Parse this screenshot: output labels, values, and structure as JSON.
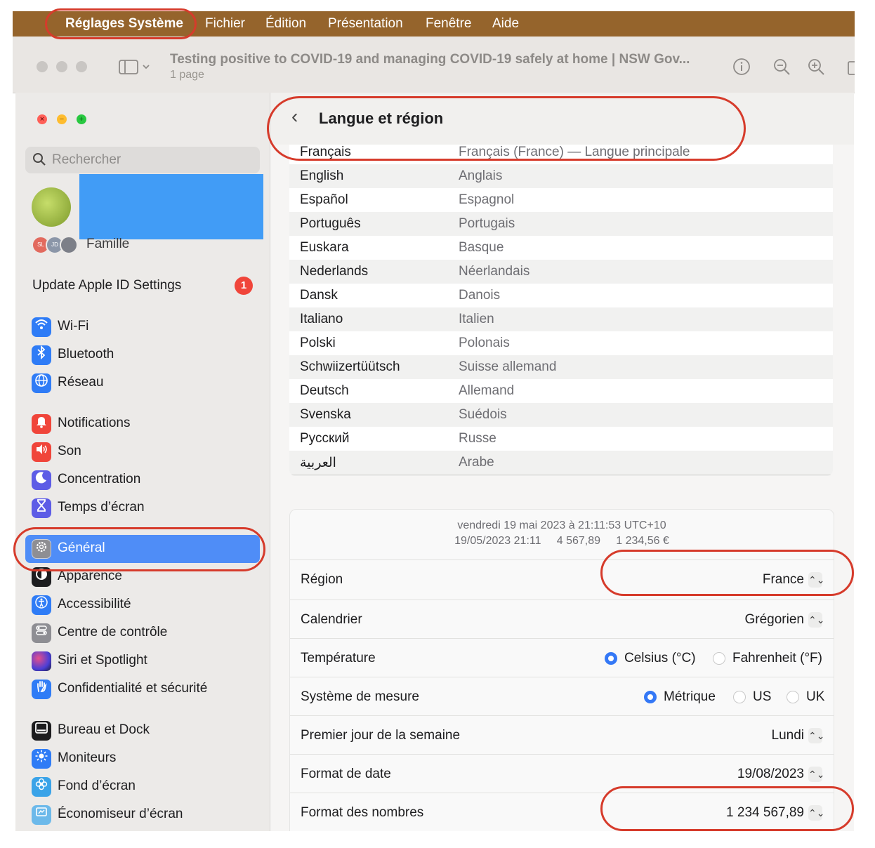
{
  "menubar": {
    "apple_icon": "",
    "app_name": "Réglages Système",
    "items": [
      "Fichier",
      "Édition",
      "Présentation",
      "Fenêtre",
      "Aide"
    ]
  },
  "preview": {
    "title": "Testing positive to COVID-19 and managing COVID-19 safely at home | NSW Gov...",
    "subtitle": "1 page",
    "icons": [
      "sidebar-toggle-icon",
      "info-icon",
      "zoom-out-icon",
      "zoom-in-icon",
      "share-icon"
    ]
  },
  "sidebar": {
    "search_placeholder": "Rechercher",
    "family_label": "Famille",
    "family_avatars": [
      "SL",
      "JD",
      ""
    ],
    "update_label": "Update Apple ID Settings",
    "update_badge": "1",
    "groups": [
      [
        {
          "label": "Wi-Fi",
          "icon": "wifi-icon",
          "color": "#2f7cf6"
        },
        {
          "label": "Bluetooth",
          "icon": "bluetooth-icon",
          "color": "#2f7cf6"
        },
        {
          "label": "Réseau",
          "icon": "globe-icon",
          "color": "#2f7cf6"
        }
      ],
      [
        {
          "label": "Notifications",
          "icon": "bell-icon",
          "color": "#f0453a"
        },
        {
          "label": "Son",
          "icon": "speaker-icon",
          "color": "#f0453a"
        },
        {
          "label": "Concentration",
          "icon": "moon-icon",
          "color": "#5d5ce6"
        },
        {
          "label": "Temps d’écran",
          "icon": "hourglass-icon",
          "color": "#5d5ce6"
        }
      ],
      [
        {
          "label": "Général",
          "icon": "gear-icon",
          "color": "#8e8e93",
          "selected": true
        },
        {
          "label": "Apparence",
          "icon": "appearance-icon",
          "color": "#1d1d1f"
        },
        {
          "label": "Accessibilité",
          "icon": "accessibility-icon",
          "color": "#2f7cf6"
        },
        {
          "label": "Centre de contrôle",
          "icon": "control-center-icon",
          "color": "#8e8e93"
        },
        {
          "label": "Siri et Spotlight",
          "icon": "siri-icon",
          "color": "#6b3fd6"
        },
        {
          "label": "Confidentialité et sécurité",
          "icon": "hand-icon",
          "color": "#2f7cf6"
        }
      ],
      [
        {
          "label": "Bureau et Dock",
          "icon": "dock-icon",
          "color": "#1d1d1f"
        },
        {
          "label": "Moniteurs",
          "icon": "sun-icon",
          "color": "#2f7cf6"
        },
        {
          "label": "Fond d’écran",
          "icon": "flower-icon",
          "color": "#3aa3e8"
        },
        {
          "label": "Économiseur d’écran",
          "icon": "screensaver-icon",
          "color": "#3aa3e8"
        }
      ]
    ]
  },
  "content": {
    "back_icon": "‹",
    "title": "Langue et région",
    "languages": [
      {
        "name": "Français",
        "translation": "Français (France) — Langue principale"
      },
      {
        "name": "English",
        "translation": "Anglais"
      },
      {
        "name": "Español",
        "translation": "Espagnol"
      },
      {
        "name": "Português",
        "translation": "Portugais"
      },
      {
        "name": "Euskara",
        "translation": "Basque"
      },
      {
        "name": "Nederlands",
        "translation": "Néerlandais"
      },
      {
        "name": "Dansk",
        "translation": "Danois"
      },
      {
        "name": "Italiano",
        "translation": "Italien"
      },
      {
        "name": "Polski",
        "translation": "Polonais"
      },
      {
        "name": "Schwiizertüütsch",
        "translation": "Suisse allemand"
      },
      {
        "name": "Deutsch",
        "translation": "Allemand"
      },
      {
        "name": "Svenska",
        "translation": "Suédois"
      },
      {
        "name": "Русский",
        "translation": "Russe"
      },
      {
        "name": "العربية",
        "translation": "Arabe"
      }
    ],
    "toolbar": {
      "add": "+",
      "remove": "−",
      "action": "⊛ ⌄"
    },
    "format_preview": {
      "line1": "vendredi 19 mai 2023 à 21:11:53 UTC+10",
      "line2": "19/05/2023 21:11     4 567,89     1 234,56 €"
    },
    "settings": {
      "region": {
        "label": "Région",
        "value": "France"
      },
      "calendar": {
        "label": "Calendrier",
        "value": "Grégorien"
      },
      "temperature": {
        "label": "Température",
        "options": [
          "Celsius (°C)",
          "Fahrenheit (°F)"
        ],
        "selected": "Celsius (°C)"
      },
      "measurement": {
        "label": "Système de mesure",
        "options": [
          "Métrique",
          "US",
          "UK"
        ],
        "selected": "Métrique"
      },
      "first_day": {
        "label": "Premier jour de la semaine",
        "value": "Lundi"
      },
      "date_format": {
        "label": "Format de date",
        "value": "19/08/2023"
      },
      "number_format": {
        "label": "Format des nombres",
        "value": "1 234 567,89"
      }
    },
    "stepper_icon": "⌃⌄"
  },
  "annotation_color": "#d63b2b"
}
